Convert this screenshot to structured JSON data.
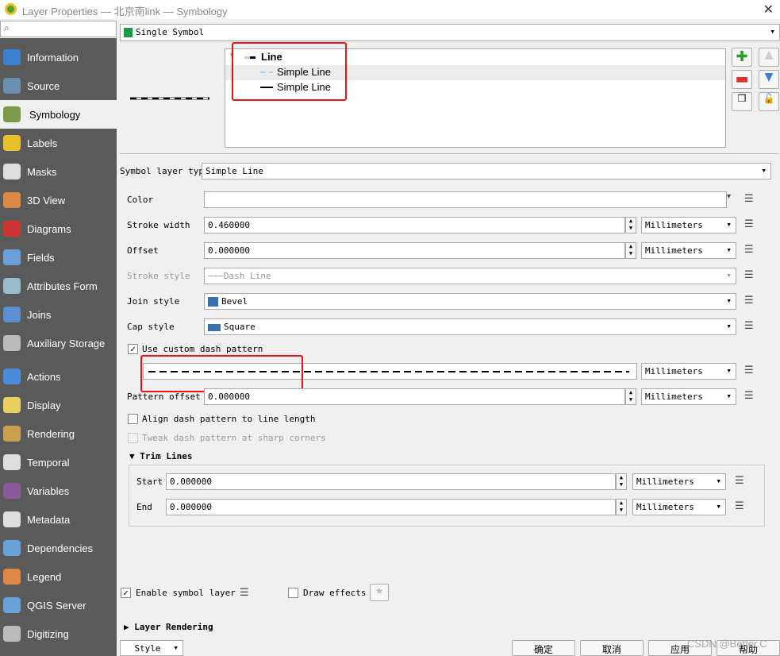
{
  "window": {
    "title": "Layer Properties — 北京南link — Symbology",
    "close": "✕"
  },
  "sidebar": {
    "items": [
      {
        "label": "Information",
        "color": "#3b7fd0"
      },
      {
        "label": "Source",
        "color": "#6a8fb0"
      },
      {
        "label": "Symbology",
        "color": "#7a9a4a"
      },
      {
        "label": "Labels",
        "color": "#e8c12a"
      },
      {
        "label": "Masks",
        "color": "#dddddd"
      },
      {
        "label": "3D View",
        "color": "#d84"
      },
      {
        "label": "Diagrams",
        "color": "#c33"
      },
      {
        "label": "Fields",
        "color": "#6aa0d8"
      },
      {
        "label": "Attributes Form",
        "color": "#9bc"
      },
      {
        "label": "Joins",
        "color": "#5a8fd0"
      },
      {
        "label": "Auxiliary Storage",
        "color": "#bbb"
      },
      {
        "label": "Actions",
        "color": "#4a8ad8"
      },
      {
        "label": "Display",
        "color": "#e8d060"
      },
      {
        "label": "Rendering",
        "color": "#c8a050"
      },
      {
        "label": "Temporal",
        "color": "#ddd"
      },
      {
        "label": "Variables",
        "color": "#8a5a9a"
      },
      {
        "label": "Metadata",
        "color": "#ddd"
      },
      {
        "label": "Dependencies",
        "color": "#6aa0d8"
      },
      {
        "label": "Legend",
        "color": "#d84"
      },
      {
        "label": "QGIS Server",
        "color": "#6aa0d8"
      },
      {
        "label": "Digitizing",
        "color": "#bbb"
      }
    ]
  },
  "renderer": {
    "value": "Single Symbol"
  },
  "tree": {
    "root": "Line",
    "children": [
      "Simple Line",
      "Simple Line"
    ]
  },
  "form": {
    "symbol_layer_type_label": "Symbol layer type",
    "symbol_layer_type": "Simple Line",
    "color_label": "Color",
    "stroke_width_label": "Stroke width",
    "stroke_width": "0.460000",
    "stroke_width_unit": "Millimeters",
    "offset_label": "Offset",
    "offset": "0.000000",
    "offset_unit": "Millimeters",
    "stroke_style_label": "Stroke style",
    "stroke_style": "Dash Line",
    "join_style_label": "Join style",
    "join_style": "Bevel",
    "cap_style_label": "Cap style",
    "cap_style": "Square",
    "custom_dash_label": "Use custom dash pattern",
    "custom_dash_checked": true,
    "dash_unit": "Millimeters",
    "pattern_offset_label": "Pattern offset",
    "pattern_offset": "0.000000",
    "pattern_offset_unit": "Millimeters",
    "align_label": "Align dash pattern to line length",
    "tweak_label": "Tweak dash pattern at sharp corners",
    "trim_title": "Trim Lines",
    "start_label": "Start",
    "start": "0.000000",
    "start_unit": "Millimeters",
    "end_label": "End",
    "end": "0.000000",
    "end_unit": "Millimeters",
    "enable_label": "Enable symbol layer",
    "enable_checked": true,
    "effects_label": "Draw effects"
  },
  "layer_rendering": "Layer Rendering",
  "buttons": {
    "style": "Style",
    "ok": "确定",
    "cancel": "取消",
    "apply": "应用",
    "help": "帮助"
  },
  "watermark": "CSDN @Better.C"
}
